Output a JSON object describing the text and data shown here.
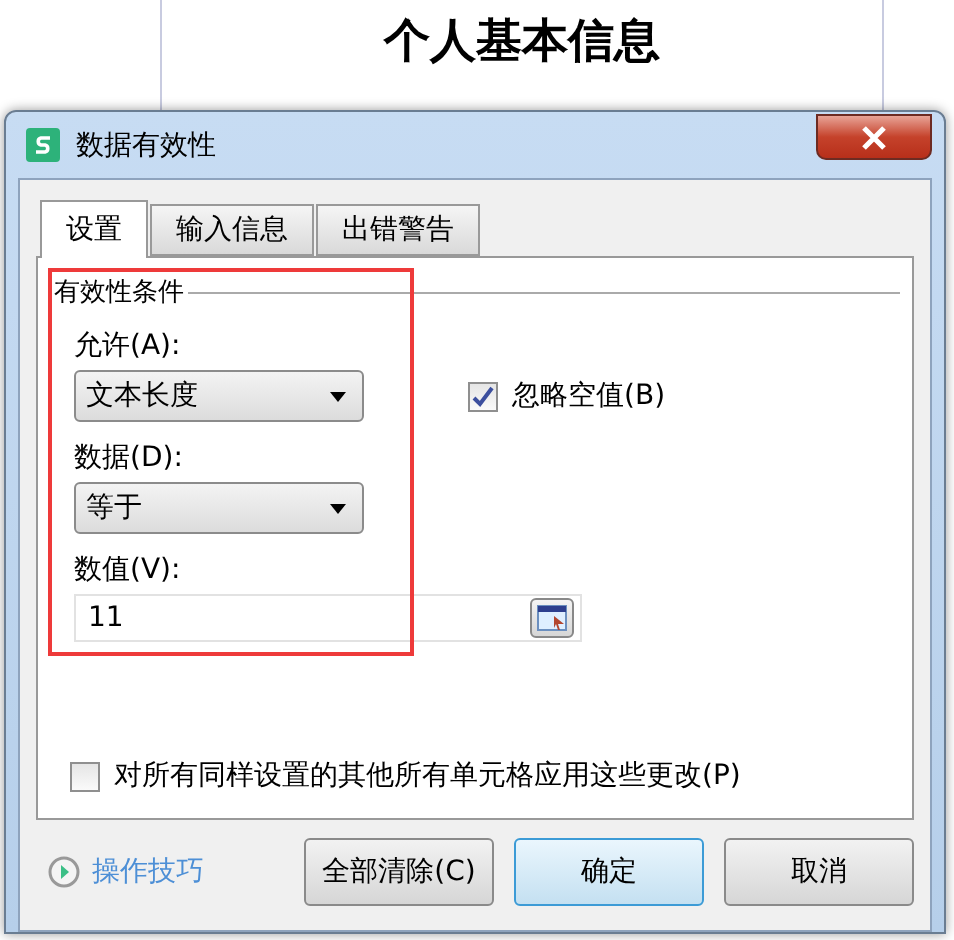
{
  "sheet": {
    "title": "个人基本信息"
  },
  "dialog": {
    "title": "数据有效性",
    "tabs": [
      {
        "label": "设置",
        "selected": true
      },
      {
        "label": "输入信息",
        "selected": false
      },
      {
        "label": "出错警告",
        "selected": false
      }
    ],
    "group": {
      "title": "有效性条件",
      "allow": {
        "label": "允许(A):",
        "value": "文本长度"
      },
      "data": {
        "label": "数据(D):",
        "value": "等于"
      },
      "value": {
        "label": "数值(V):",
        "value": "11"
      },
      "ignore_blank": {
        "label": "忽略空值(B)",
        "checked": true
      }
    },
    "apply_all": {
      "label": "对所有同样设置的其他所有单元格应用这些更改(P)",
      "checked": false
    },
    "tips_link": "操作技巧",
    "buttons": [
      {
        "label": "全部清除(C)",
        "kind": "normal"
      },
      {
        "label": "确定",
        "kind": "default"
      },
      {
        "label": "取消",
        "kind": "normal"
      }
    ]
  }
}
